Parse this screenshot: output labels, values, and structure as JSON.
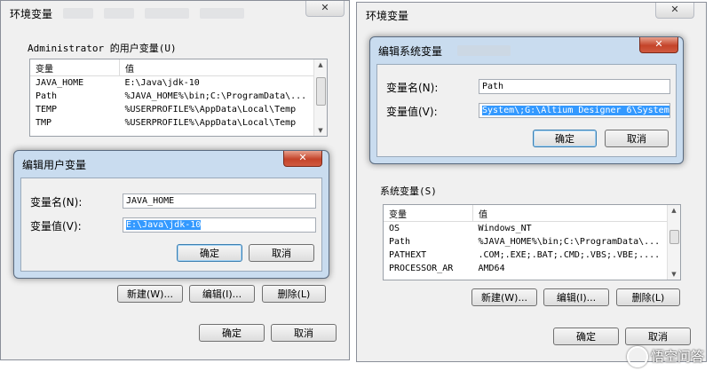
{
  "left_window": {
    "title": "环境变量",
    "user_group_label": "Administrator 的用户变量(U)",
    "columns": [
      "变量",
      "值"
    ],
    "rows": [
      {
        "name": "JAVA_HOME",
        "value": "E:\\Java\\jdk-10"
      },
      {
        "name": "Path",
        "value": "%JAVA_HOME%\\bin;C:\\ProgramData\\..."
      },
      {
        "name": "TEMP",
        "value": "%USERPROFILE%\\AppData\\Local\\Temp"
      },
      {
        "name": "TMP",
        "value": "%USERPROFILE%\\AppData\\Local\\Temp"
      }
    ],
    "new_label": "新建(W)...",
    "edit_label": "编辑(I)...",
    "delete_label": "删除(L)",
    "ok_label": "确定",
    "cancel_label": "取消",
    "close_glyph": "✕"
  },
  "user_dialog": {
    "title": "编辑用户变量",
    "name_label": "变量名(N):",
    "name_value": "JAVA_HOME",
    "value_label": "变量值(V):",
    "value_value": "E:\\Java\\jdk-10",
    "ok_label": "确定",
    "cancel_label": "取消",
    "close_glyph": "✕"
  },
  "right_window": {
    "title": "环境变量",
    "system_group_label": "系统变量(S)",
    "columns": [
      "变量",
      "值"
    ],
    "rows": [
      {
        "name": "OS",
        "value": "Windows_NT"
      },
      {
        "name": "Path",
        "value": "%JAVA_HOME%\\bin;C:\\ProgramData\\..."
      },
      {
        "name": "PATHEXT",
        "value": ".COM;.EXE;.BAT;.CMD;.VBS;.VBE;...."
      },
      {
        "name": "PROCESSOR_AR",
        "value": "AMD64"
      }
    ],
    "new_label": "新建(W)...",
    "edit_label": "编辑(I)...",
    "delete_label": "删除(L)",
    "ok_label": "确定",
    "cancel_label": "取消",
    "close_glyph": "✕"
  },
  "system_dialog": {
    "title": "编辑系统变量",
    "name_label": "变量名(N):",
    "name_value": "Path",
    "value_label": "变量值(V):",
    "value_value": "System\\;G:\\Altium Designer 6\\System",
    "ok_label": "确定",
    "cancel_label": "取消",
    "close_glyph": "✕"
  },
  "watermark": {
    "text": "悟空问答"
  },
  "colors": {
    "selection": "#3399ff",
    "dialog_frame": "#c9dcef",
    "close_red": "#c4442a"
  }
}
